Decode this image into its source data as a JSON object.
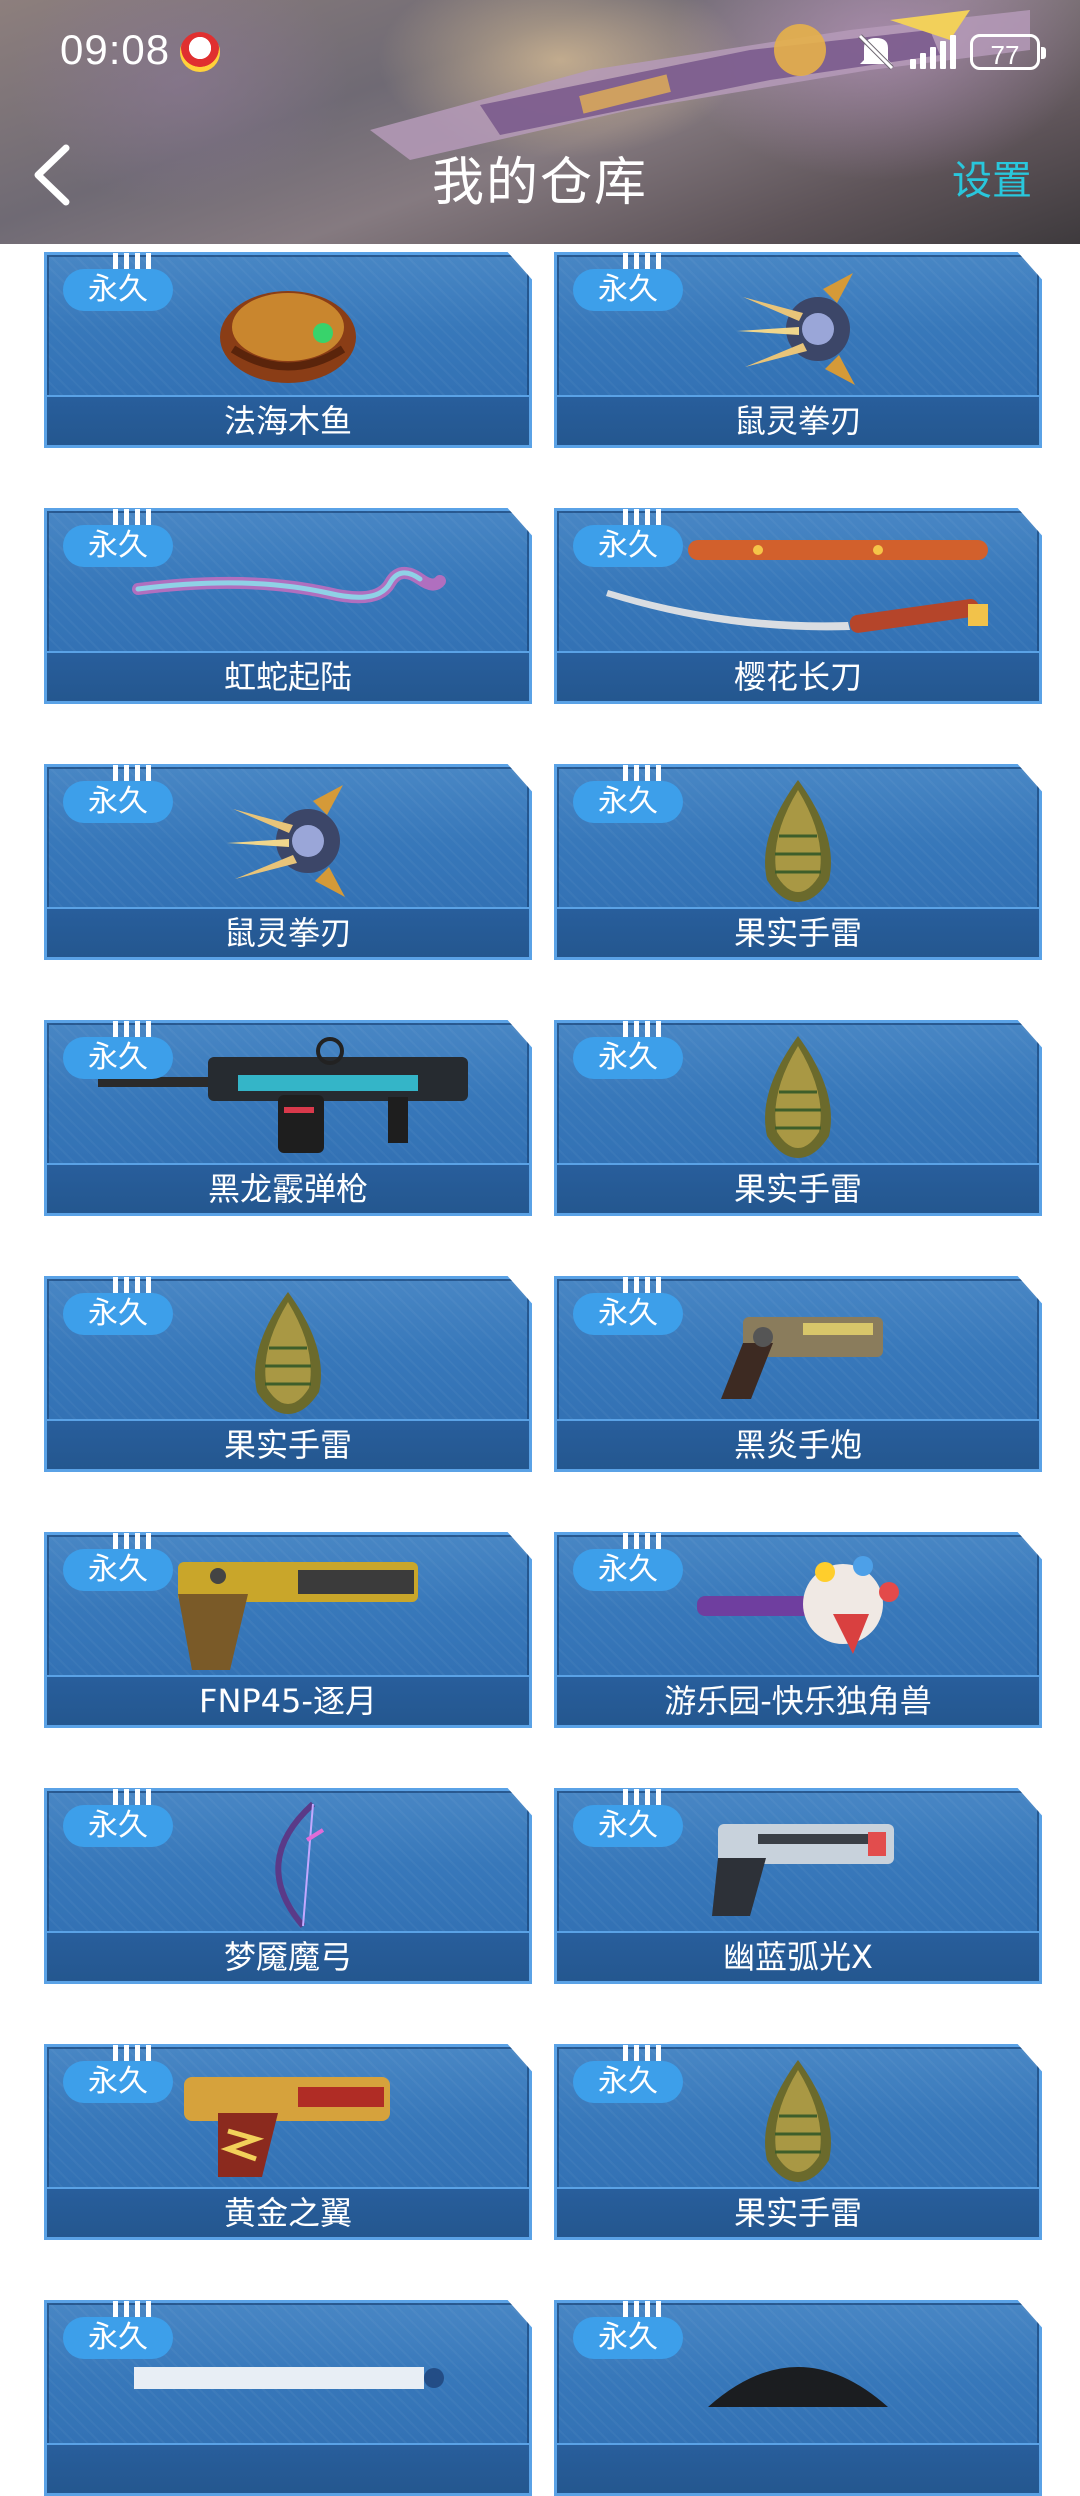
{
  "status_bar": {
    "time": "09:08",
    "battery": "77"
  },
  "header": {
    "title": "我的仓库",
    "settings_label": "设置"
  },
  "badge_label": "永久",
  "items": [
    {
      "name": "法海木鱼",
      "icon": "wooden-fish-icon"
    },
    {
      "name": "鼠灵拳刃",
      "icon": "claw-blade-icon"
    },
    {
      "name": "虹蛇起陆",
      "icon": "rainbow-snake-icon"
    },
    {
      "name": "樱花长刀",
      "icon": "katana-icon"
    },
    {
      "name": "鼠灵拳刃",
      "icon": "claw-blade-icon"
    },
    {
      "name": "果实手雷",
      "icon": "fruit-grenade-icon"
    },
    {
      "name": "黑龙霰弹枪",
      "icon": "shotgun-icon"
    },
    {
      "name": "果实手雷",
      "icon": "fruit-grenade-icon"
    },
    {
      "name": "果实手雷",
      "icon": "fruit-grenade-icon"
    },
    {
      "name": "黑炎手炮",
      "icon": "hand-cannon-icon"
    },
    {
      "name": "FNP45-逐月",
      "icon": "pistol-icon"
    },
    {
      "name": "游乐园-快乐独角兽",
      "icon": "unicorn-hammer-icon"
    },
    {
      "name": "梦魇魔弓",
      "icon": "bow-icon"
    },
    {
      "name": "幽蓝弧光X",
      "icon": "blue-pistol-icon"
    },
    {
      "name": "黄金之翼",
      "icon": "golden-pistol-icon"
    },
    {
      "name": "果实手雷",
      "icon": "fruit-grenade-icon"
    },
    {
      "name": "",
      "icon": "ruler-weapon-icon"
    },
    {
      "name": "",
      "icon": "spiked-wheel-icon"
    }
  ]
}
